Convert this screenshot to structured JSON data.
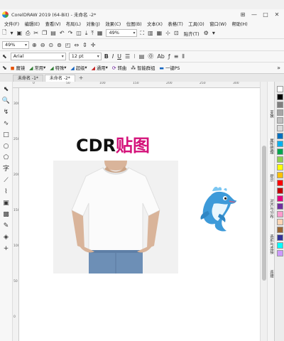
{
  "window": {
    "title": "CorelDRAW 2019 (64-Bit) - 未命名 -2*",
    "controls": [
      "⊞",
      "—",
      "□",
      "✕"
    ]
  },
  "menu": {
    "items": [
      "文件(F)",
      "编辑(E)",
      "查看(V)",
      "布局(L)",
      "对象(J)",
      "效果(C)",
      "位图(B)",
      "文本(X)",
      "表格(T)",
      "工具(O)",
      "窗口(W)",
      "帮助(H)"
    ]
  },
  "standard_toolbar": {
    "zoom_value": "49%",
    "snap_label": "贴齐(T)"
  },
  "property_bar1": {
    "zoom_value": "49%"
  },
  "property_bar2": {
    "font_name": "Arial",
    "font_size": "12 pt",
    "bold": "B",
    "italic": "I",
    "underline": "U"
  },
  "plugin_bar": {
    "items": [
      "魔镜",
      "常用",
      "特殊",
      "超级",
      "通用",
      "转曲",
      "智能群组",
      "一键PS"
    ]
  },
  "doc_tabs": {
    "tabs": [
      "未命名 -1*",
      "未命名 -2*"
    ],
    "plus": "+"
  },
  "ruler": {
    "h_ticks": [
      "0",
      "50",
      "100",
      "150",
      "200",
      "250",
      "300"
    ],
    "v_ticks": [
      "300",
      "250",
      "200",
      "150",
      "100",
      "50",
      "0"
    ]
  },
  "canvas": {
    "title_part1": "CDR",
    "title_part2": "贴图",
    "title_colors": {
      "part1": "#111111",
      "part2": "#d4127a"
    }
  },
  "dockers": {
    "items": [
      "变换",
      "属性管理",
      "提示",
      "对齐与分布",
      "造形与连接",
      "连接"
    ]
  },
  "palette": {
    "colors": [
      "#ffffff",
      "#000000",
      "#7f7f7f",
      "#a6a6a6",
      "#bfbfbf",
      "#d9d9d9",
      "#0070c0",
      "#00b0f0",
      "#00a650",
      "#92d050",
      "#ffff00",
      "#ffc000",
      "#ff0000",
      "#c00000",
      "#e6007e",
      "#7030a0",
      "#ff99cc",
      "#fcd5b4",
      "#996633",
      "#333399",
      "#00ffff",
      "#cc99ff"
    ]
  },
  "icons": [
    "select-tool",
    "shape-tool",
    "crop-tool",
    "zoom-tool",
    "freehand-tool",
    "rectangle-tool",
    "ellipse-tool",
    "polygon-tool",
    "text-tool",
    "parallel-dimension-tool",
    "connector-tool",
    "drop-shadow-tool",
    "transparency-tool",
    "eyedropper-tool",
    "fill-tool",
    "smart-fill-tool"
  ]
}
